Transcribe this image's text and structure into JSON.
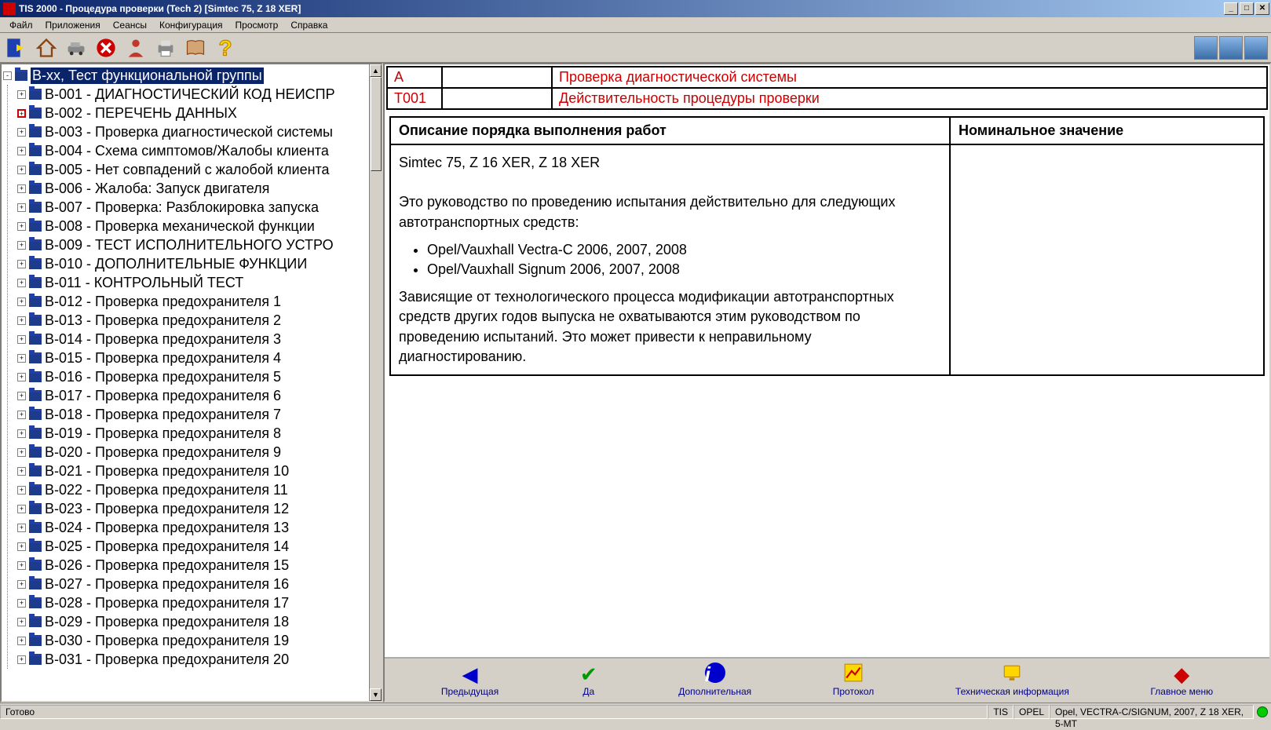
{
  "title": "TIS 2000 - Процедура проверки (Tech 2) [Simtec 75, Z 18 XER]",
  "menu": {
    "file": "Файл",
    "apps": "Приложения",
    "sessions": "Сеансы",
    "config": "Конфигурация",
    "view": "Просмотр",
    "help": "Справка"
  },
  "tree": {
    "root": "B-xx, Тест функциональной группы",
    "items": [
      "B-001 - ДИАГНОСТИЧЕСКИЙ КОД НЕИСПР",
      "B-002 - ПЕРЕЧЕНЬ ДАННЫХ",
      "B-003 - Проверка диагностической системы",
      "B-004 - Схема симптомов/Жалобы клиента",
      "B-005 - Нет совпадений с жалобой клиента",
      "B-006 - Жалоба: Запуск двигателя",
      "B-007 - Проверка: Разблокировка запуска",
      "B-008 - Проверка механической функции",
      "B-009 - ТЕСТ ИСПОЛНИТЕЛЬНОГО УСТРО",
      "B-010 - ДОПОЛНИТЕЛЬНЫЕ ФУНКЦИИ",
      "B-011 - КОНТРОЛЬНЫЙ ТЕСТ",
      "B-012 - Проверка предохранителя 1",
      "B-013 - Проверка предохранителя 2",
      "B-014 - Проверка предохранителя 3",
      "B-015 - Проверка предохранителя 4",
      "B-016 - Проверка предохранителя 5",
      "B-017 - Проверка предохранителя 6",
      "B-018 - Проверка предохранителя 7",
      "B-019 - Проверка предохранителя 8",
      "B-020 - Проверка предохранителя 9",
      "B-021 - Проверка предохранителя 10",
      "B-022 - Проверка предохранителя 11",
      "B-023 - Проверка предохранителя 12",
      "B-024 - Проверка предохранителя 13",
      "B-025 - Проверка предохранителя 14",
      "B-026 - Проверка предохранителя 15",
      "B-027 - Проверка предохранителя 16",
      "B-028 - Проверка предохранителя 17",
      "B-029 - Проверка предохранителя 18",
      "B-030 - Проверка предохранителя 19",
      "B-031 - Проверка предохранителя 20"
    ]
  },
  "header": {
    "r1c1": "A",
    "r1c3": "Проверка диагностической системы",
    "r2c1": "T001",
    "r2c3": "Действительность процедуры проверки"
  },
  "desc": {
    "col1_header": "Описание порядка выполнения работ",
    "col2_header": "Номинальное значение",
    "line1": "Simtec 75, Z 16 XER, Z 18 XER",
    "line2": "Это руководство по проведению испытания действительно для следующих автотранспортных средств:",
    "bullet1": "Opel/Vauxhall Vectra-C 2006, 2007, 2008",
    "bullet2": "Opel/Vauxhall Signum 2006, 2007, 2008",
    "line3": "Зависящие от технологического процесса модификации автотранспортных средств других годов выпуска не охватываются этим руководством по проведению испытаний. Это может привести к неправильному диагностированию."
  },
  "bottom": {
    "prev": "Предыдущая",
    "yes": "Да",
    "extra": "Дополнительная",
    "proto": "Протокол",
    "tech": "Техническая информация",
    "main": "Главное меню"
  },
  "status": {
    "ready": "Готово",
    "tis": "TIS",
    "opel": "OPEL",
    "vehicle": "Opel, VECTRA-C/SIGNUM, 2007, Z 18 XER, 5-MT"
  }
}
